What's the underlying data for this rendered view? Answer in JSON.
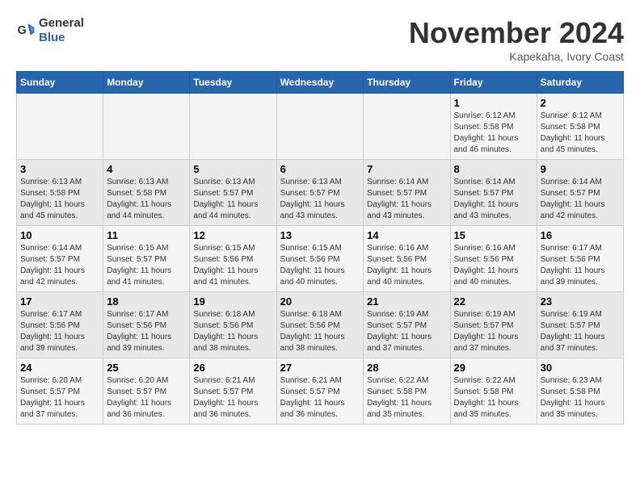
{
  "logo": {
    "general": "General",
    "blue": "Blue"
  },
  "title": "November 2024",
  "location": "Kapekaha, Ivory Coast",
  "days_header": [
    "Sunday",
    "Monday",
    "Tuesday",
    "Wednesday",
    "Thursday",
    "Friday",
    "Saturday"
  ],
  "weeks": [
    [
      {
        "day": "",
        "info": ""
      },
      {
        "day": "",
        "info": ""
      },
      {
        "day": "",
        "info": ""
      },
      {
        "day": "",
        "info": ""
      },
      {
        "day": "",
        "info": ""
      },
      {
        "day": "1",
        "info": "Sunrise: 6:12 AM\nSunset: 5:58 PM\nDaylight: 11 hours and 46 minutes."
      },
      {
        "day": "2",
        "info": "Sunrise: 6:12 AM\nSunset: 5:58 PM\nDaylight: 11 hours and 45 minutes."
      }
    ],
    [
      {
        "day": "3",
        "info": "Sunrise: 6:13 AM\nSunset: 5:58 PM\nDaylight: 11 hours and 45 minutes."
      },
      {
        "day": "4",
        "info": "Sunrise: 6:13 AM\nSunset: 5:58 PM\nDaylight: 11 hours and 44 minutes."
      },
      {
        "day": "5",
        "info": "Sunrise: 6:13 AM\nSunset: 5:57 PM\nDaylight: 11 hours and 44 minutes."
      },
      {
        "day": "6",
        "info": "Sunrise: 6:13 AM\nSunset: 5:57 PM\nDaylight: 11 hours and 43 minutes."
      },
      {
        "day": "7",
        "info": "Sunrise: 6:14 AM\nSunset: 5:57 PM\nDaylight: 11 hours and 43 minutes."
      },
      {
        "day": "8",
        "info": "Sunrise: 6:14 AM\nSunset: 5:57 PM\nDaylight: 11 hours and 43 minutes."
      },
      {
        "day": "9",
        "info": "Sunrise: 6:14 AM\nSunset: 5:57 PM\nDaylight: 11 hours and 42 minutes."
      }
    ],
    [
      {
        "day": "10",
        "info": "Sunrise: 6:14 AM\nSunset: 5:57 PM\nDaylight: 11 hours and 42 minutes."
      },
      {
        "day": "11",
        "info": "Sunrise: 6:15 AM\nSunset: 5:57 PM\nDaylight: 11 hours and 41 minutes."
      },
      {
        "day": "12",
        "info": "Sunrise: 6:15 AM\nSunset: 5:56 PM\nDaylight: 11 hours and 41 minutes."
      },
      {
        "day": "13",
        "info": "Sunrise: 6:15 AM\nSunset: 5:56 PM\nDaylight: 11 hours and 40 minutes."
      },
      {
        "day": "14",
        "info": "Sunrise: 6:16 AM\nSunset: 5:56 PM\nDaylight: 11 hours and 40 minutes."
      },
      {
        "day": "15",
        "info": "Sunrise: 6:16 AM\nSunset: 5:56 PM\nDaylight: 11 hours and 40 minutes."
      },
      {
        "day": "16",
        "info": "Sunrise: 6:17 AM\nSunset: 5:56 PM\nDaylight: 11 hours and 39 minutes."
      }
    ],
    [
      {
        "day": "17",
        "info": "Sunrise: 6:17 AM\nSunset: 5:56 PM\nDaylight: 11 hours and 39 minutes."
      },
      {
        "day": "18",
        "info": "Sunrise: 6:17 AM\nSunset: 5:56 PM\nDaylight: 11 hours and 39 minutes."
      },
      {
        "day": "19",
        "info": "Sunrise: 6:18 AM\nSunset: 5:56 PM\nDaylight: 11 hours and 38 minutes."
      },
      {
        "day": "20",
        "info": "Sunrise: 6:18 AM\nSunset: 5:56 PM\nDaylight: 11 hours and 38 minutes."
      },
      {
        "day": "21",
        "info": "Sunrise: 6:19 AM\nSunset: 5:57 PM\nDaylight: 11 hours and 37 minutes."
      },
      {
        "day": "22",
        "info": "Sunrise: 6:19 AM\nSunset: 5:57 PM\nDaylight: 11 hours and 37 minutes."
      },
      {
        "day": "23",
        "info": "Sunrise: 6:19 AM\nSunset: 5:57 PM\nDaylight: 11 hours and 37 minutes."
      }
    ],
    [
      {
        "day": "24",
        "info": "Sunrise: 6:20 AM\nSunset: 5:57 PM\nDaylight: 11 hours and 37 minutes."
      },
      {
        "day": "25",
        "info": "Sunrise: 6:20 AM\nSunset: 5:57 PM\nDaylight: 11 hours and 36 minutes."
      },
      {
        "day": "26",
        "info": "Sunrise: 6:21 AM\nSunset: 5:57 PM\nDaylight: 11 hours and 36 minutes."
      },
      {
        "day": "27",
        "info": "Sunrise: 6:21 AM\nSunset: 5:57 PM\nDaylight: 11 hours and 36 minutes."
      },
      {
        "day": "28",
        "info": "Sunrise: 6:22 AM\nSunset: 5:58 PM\nDaylight: 11 hours and 35 minutes."
      },
      {
        "day": "29",
        "info": "Sunrise: 6:22 AM\nSunset: 5:58 PM\nDaylight: 11 hours and 35 minutes."
      },
      {
        "day": "30",
        "info": "Sunrise: 6:23 AM\nSunset: 5:58 PM\nDaylight: 11 hours and 35 minutes."
      }
    ]
  ]
}
